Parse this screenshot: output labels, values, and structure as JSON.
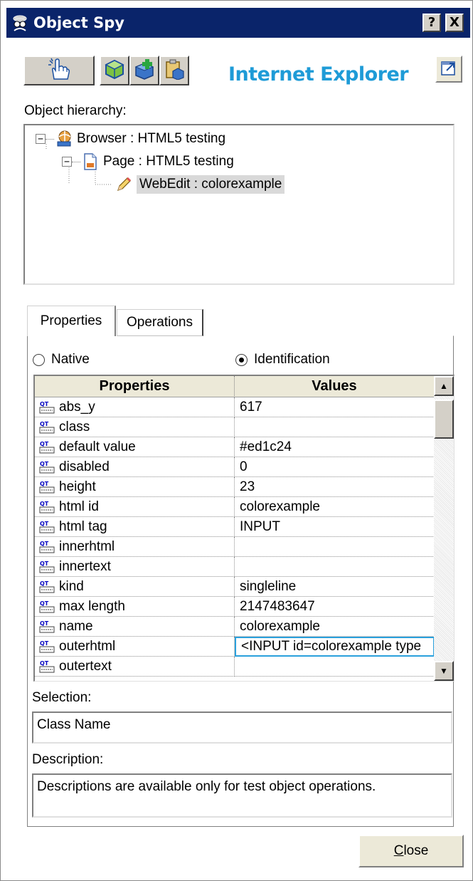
{
  "window": {
    "title": "Object Spy",
    "help_glyph": "?",
    "close_glyph": "X"
  },
  "toolbar": {
    "browser_label": "Internet Explorer",
    "buttons": [
      "pointing-hand-icon",
      "highlight-object-icon",
      "add-object-icon",
      "copy-object-icon"
    ]
  },
  "hierarchy": {
    "label": "Object hierarchy:",
    "nodes": [
      {
        "text": "Browser : HTML5 testing",
        "expander": "−"
      },
      {
        "text": "Page : HTML5 testing",
        "expander": "−"
      },
      {
        "text": "WebEdit : colorexample"
      }
    ]
  },
  "tabs": {
    "properties": "Properties",
    "operations": "Operations"
  },
  "mode": {
    "native": "Native",
    "identification": "Identification",
    "selected": "Identification"
  },
  "grid": {
    "header_properties": "Properties",
    "header_values": "Values",
    "rows": [
      {
        "prop": "abs_y",
        "value": "617"
      },
      {
        "prop": "class",
        "value": ""
      },
      {
        "prop": "default value",
        "value": "#ed1c24"
      },
      {
        "prop": "disabled",
        "value": "0"
      },
      {
        "prop": "height",
        "value": "23"
      },
      {
        "prop": "html id",
        "value": "colorexample"
      },
      {
        "prop": "html tag",
        "value": "INPUT"
      },
      {
        "prop": "innerhtml",
        "value": ""
      },
      {
        "prop": "innertext",
        "value": ""
      },
      {
        "prop": "kind",
        "value": "singleline"
      },
      {
        "prop": "max length",
        "value": "2147483647"
      },
      {
        "prop": "name",
        "value": "colorexample"
      },
      {
        "prop": "outerhtml",
        "value": "<INPUT id=colorexample type"
      },
      {
        "prop": "outertext",
        "value": ""
      }
    ],
    "scroll_up": "▲",
    "scroll_down": "▼"
  },
  "selection": {
    "label": "Selection:",
    "value": "Class Name"
  },
  "description": {
    "label": "Description:",
    "value": "Descriptions are available only for test object operations."
  },
  "close_label": "Close",
  "colors": {
    "titlebar": "#0a246a",
    "accent": "#1e9bd7",
    "highlight": "#2aa0dc"
  }
}
